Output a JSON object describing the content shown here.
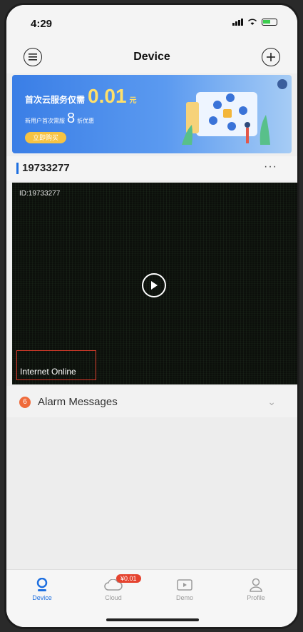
{
  "status_bar": {
    "time": "4:29"
  },
  "header": {
    "title": "Device"
  },
  "banner": {
    "headline": "首次云服务仅需",
    "price": "0.01",
    "unit": "元",
    "sub_text": "新用户首次需服",
    "sub_highlight": "8",
    "sub_suffix": "折优惠",
    "cta": "立即购买"
  },
  "device": {
    "name": "19733277",
    "more_label": "···",
    "video_id_label": "ID:19733277",
    "status_text": "Internet Online"
  },
  "alarm": {
    "label": "Alarm Messages",
    "badge": "6"
  },
  "tabs": [
    {
      "label": "Device"
    },
    {
      "label": "Cloud",
      "badge": "¥0.01"
    },
    {
      "label": "Demo"
    },
    {
      "label": "Profile"
    }
  ],
  "colors": {
    "accent": "#1d6fe0",
    "badge_red": "#e5432f",
    "banner_blue": "#3a7ee6"
  }
}
